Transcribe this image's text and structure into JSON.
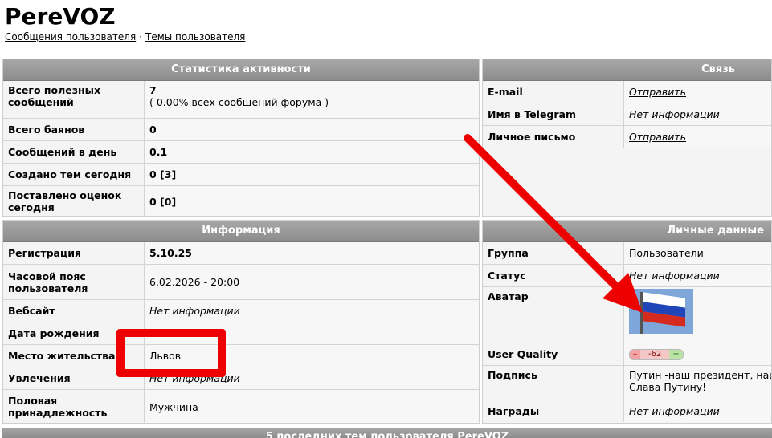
{
  "site": {
    "title": "PereVOZ",
    "links": [
      "Сообщения пользователя",
      "Темы пользователя"
    ],
    "separator": "·"
  },
  "activity": {
    "title": "Статистика активности",
    "rows": [
      {
        "label": "Всего полезных сообщений",
        "value": "7",
        "sub": "( 0.00% всех сообщений форума )"
      },
      {
        "label": "Всего баянов",
        "value": "0"
      },
      {
        "label": "Сообщений в день",
        "value": "0.1"
      },
      {
        "label": "Создано тем сегодня",
        "value": "0 [3]"
      },
      {
        "label": "Поставлено оценок сегодня",
        "value": "0 [0]"
      }
    ]
  },
  "contact": {
    "title": "Связь",
    "rows": [
      {
        "label": "E-mail",
        "value": "Отправить"
      },
      {
        "label": "Имя в Telegram",
        "value": "Нет информации"
      },
      {
        "label": "Личное письмо",
        "value": "Отправить"
      }
    ]
  },
  "info": {
    "title": "Информация",
    "rows": [
      {
        "label": "Регистрация",
        "value": "5.10.25"
      },
      {
        "label": "Часовой пояс пользователя",
        "value": "6.02.2026 - 20:00"
      },
      {
        "label": "Вебсайт",
        "value": "Нет информации"
      },
      {
        "label": "Дата рождения",
        "value": ""
      },
      {
        "label": "Место жительства",
        "value": "Львов"
      },
      {
        "label": "Увлечения",
        "value": "Нет информации"
      },
      {
        "label": "Половая принадлежность",
        "value": "Мужчина"
      }
    ]
  },
  "personal": {
    "title": "Личные данные",
    "rows": [
      {
        "label": "Группа",
        "value": "Пользователи"
      },
      {
        "label": "Статус",
        "value": "Нет информации"
      },
      {
        "label": "Аватар",
        "value": ""
      },
      {
        "label": "User Quality",
        "minus": "–",
        "value": "-62",
        "plus": "+"
      },
      {
        "label": "Подпись",
        "value": "Путин -наш президент, наш",
        "value2": "Слава Путину!"
      },
      {
        "label": "Награды",
        "value": "Нет информации"
      }
    ]
  },
  "annotations": {
    "box_color": "#ee0000",
    "arrow_color": "#ee0000"
  },
  "bottom": {
    "title": "5 последних тем пользователя PereVOZ"
  }
}
